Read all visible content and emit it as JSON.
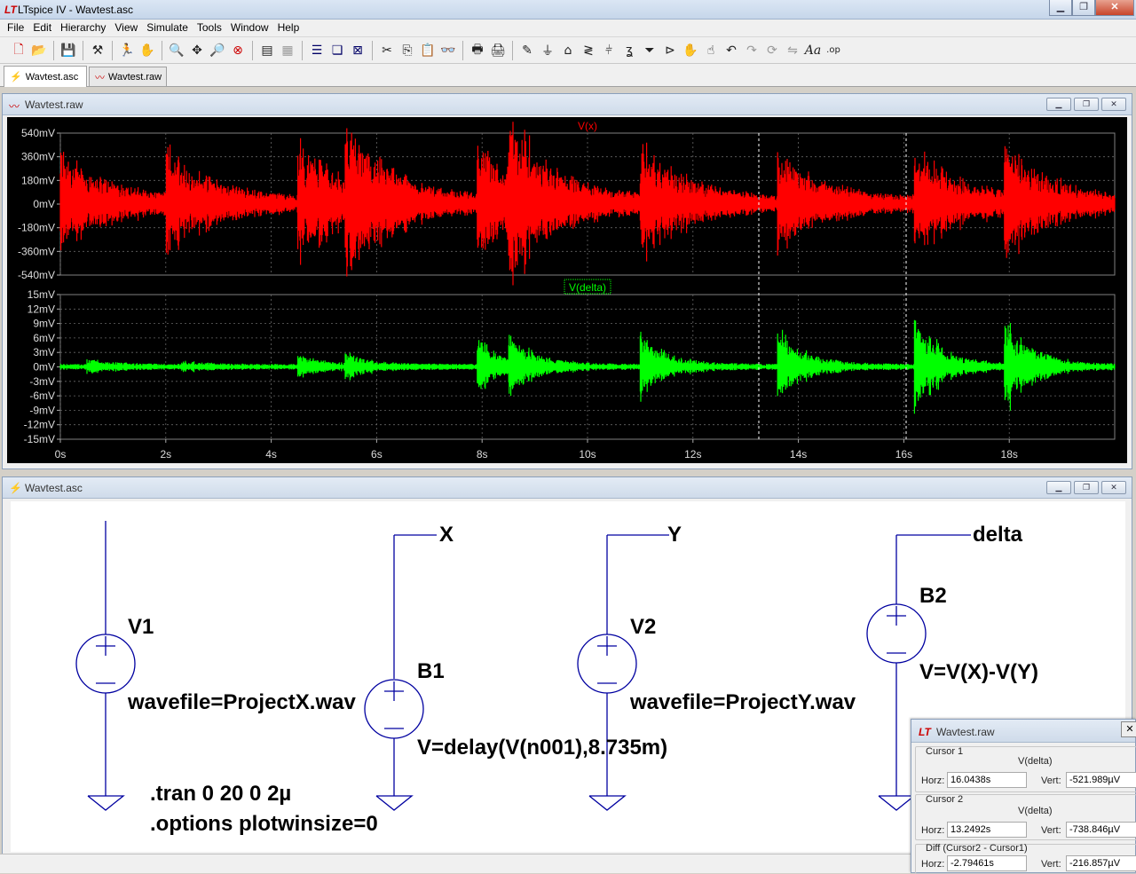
{
  "app": {
    "title": "LTspice IV - Wavtest.asc",
    "logo": "LT"
  },
  "menu": [
    "File",
    "Edit",
    "Hierarchy",
    "View",
    "Simulate",
    "Tools",
    "Window",
    "Help"
  ],
  "toolbar": {
    "icons": [
      "new-schematic",
      "open",
      "save",
      "control-panel",
      "run",
      "halt",
      "zoom-in",
      "pan",
      "zoom-out",
      "zoom-fit",
      "autorange",
      "manual-limits",
      "tile-horizontal",
      "cascade",
      "close-all",
      "cut",
      "copy",
      "paste",
      "find",
      "print-setup",
      "print",
      "draw-wire",
      "ground",
      "label-net",
      "resistor",
      "capacitor",
      "inductor",
      "diode",
      "component",
      "move",
      "drag",
      "undo",
      "redo",
      "rotate",
      "mirror",
      "text",
      "spice-directive"
    ]
  },
  "tabs": [
    {
      "label": "Wavtest.asc",
      "icon": "schematic-icon"
    },
    {
      "label": "Wavtest.raw",
      "icon": "waveform-icon"
    }
  ],
  "wave_window": {
    "title": "Wavtest.raw"
  },
  "schem_window": {
    "title": "Wavtest.asc"
  },
  "chart_data": [
    {
      "type": "line",
      "title": "V(x)",
      "series": [
        {
          "name": "V(x)",
          "color": "#ff0000"
        }
      ],
      "ylim": [
        -540,
        540
      ],
      "yunit": "mV",
      "y_ticks": [
        "540mV",
        "360mV",
        "180mV",
        "0mV",
        "-180mV",
        "-360mV",
        "-540mV"
      ],
      "bursts_s": [
        0,
        2,
        4.5,
        5.4,
        7.9,
        8.5,
        11,
        13.6,
        16.2,
        17.9
      ],
      "burst_peaks_mV": [
        450,
        450,
        520,
        520,
        500,
        500,
        470,
        420,
        450,
        450
      ],
      "xlim": [
        0,
        20
      ]
    },
    {
      "type": "line",
      "title": "V(delta)",
      "series": [
        {
          "name": "V(delta)",
          "color": "#00ff00"
        }
      ],
      "ylim": [
        -15,
        15
      ],
      "yunit": "mV",
      "y_ticks": [
        "15mV",
        "12mV",
        "9mV",
        "6mV",
        "3mV",
        "0mV",
        "-3mV",
        "-6mV",
        "-9mV",
        "-12mV",
        "-15mV"
      ],
      "bursts_s": [
        0.5,
        2.3,
        4.5,
        5.4,
        7.9,
        8.5,
        11,
        13.6,
        16.2,
        17.9
      ],
      "burst_peaks_mV": [
        1.5,
        1,
        2.5,
        2.5,
        7,
        6,
        8,
        9,
        12.5,
        12
      ],
      "xlim": [
        0,
        20
      ]
    }
  ],
  "x_axis": {
    "ticks": [
      "0s",
      "2s",
      "4s",
      "6s",
      "8s",
      "10s",
      "12s",
      "14s",
      "16s",
      "18s"
    ]
  },
  "cursor_lines_s": [
    13.2492,
    16.0438
  ],
  "schematic": {
    "v1": {
      "name": "V1",
      "value": "wavefile=ProjectX.wav"
    },
    "b1": {
      "name": "B1",
      "value": "V=delay(V(n001),8.735m)"
    },
    "v2": {
      "name": "V2",
      "value": "wavefile=ProjectY.wav"
    },
    "b2": {
      "name": "B2",
      "value": "V=V(X)-V(Y)"
    },
    "nets": {
      "x": "X",
      "y": "Y",
      "delta": "delta"
    },
    "directives": [
      ".tran 0 20 0 2µ",
      ".options plotwinsize=0"
    ]
  },
  "cursor_window": {
    "title": "Wavtest.raw",
    "cursor1": {
      "label": "Cursor 1",
      "trace": "V(delta)",
      "horz_label": "Horz:",
      "horz": "16.0438s",
      "vert_label": "Vert:",
      "vert": "-521.989µV"
    },
    "cursor2": {
      "label": "Cursor 2",
      "trace": "V(delta)",
      "horz_label": "Horz:",
      "horz": "13.2492s",
      "vert_label": "Vert:",
      "vert": "-738.846µV"
    },
    "diff": {
      "label": "Diff (Cursor2 - Cursor1)",
      "horz_label": "Horz:",
      "horz": "-2.79461s",
      "vert_label": "Vert:",
      "vert": "-216.857µV"
    }
  }
}
